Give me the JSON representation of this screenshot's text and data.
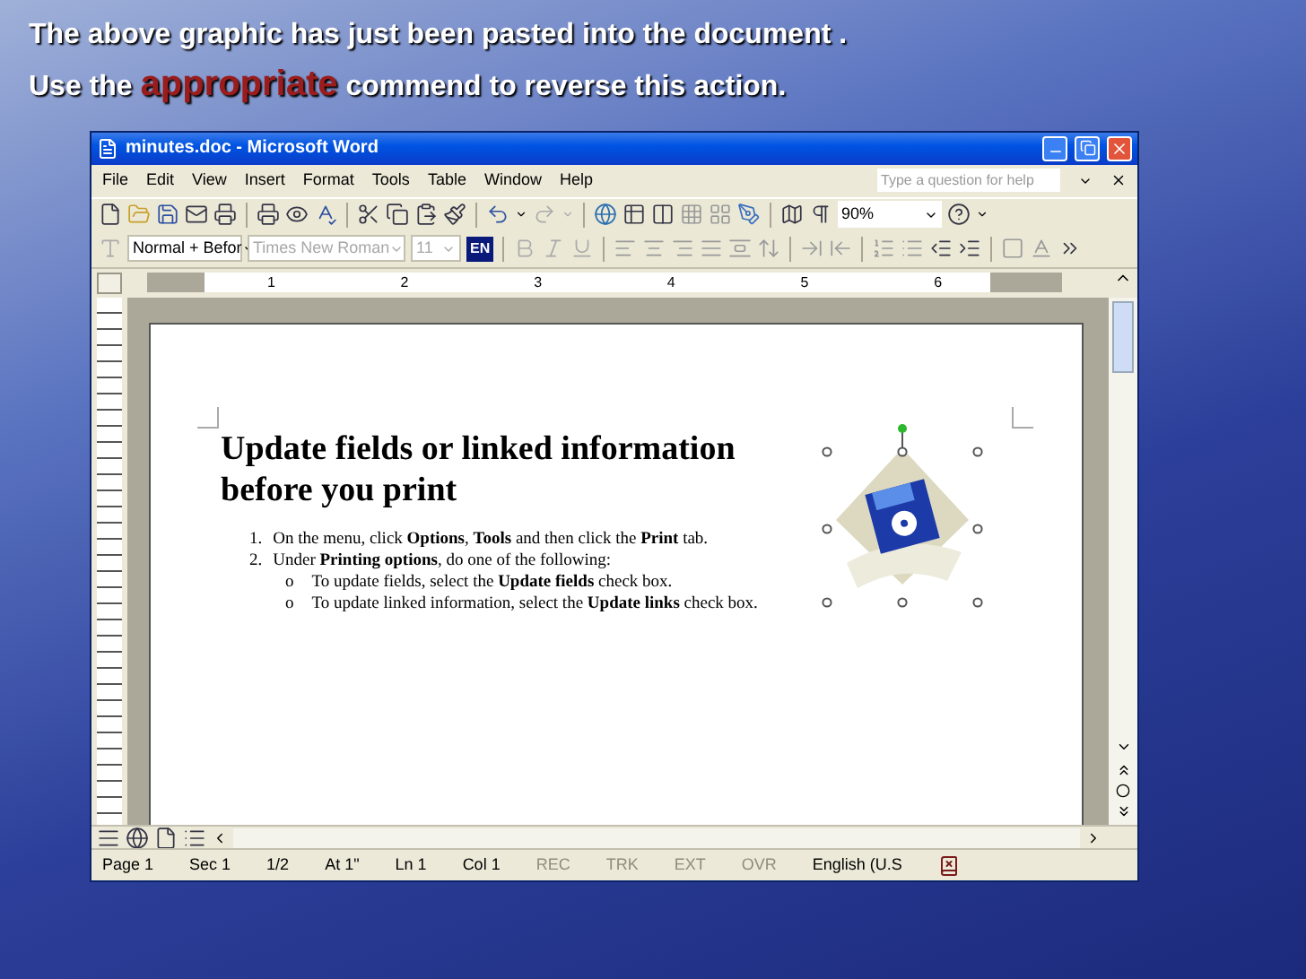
{
  "caption": {
    "line_1": "The above graphic has just been pasted into the document .",
    "line_2": [
      {
        "text": "Use the ",
        "emphasis": false
      },
      {
        "text": "appropriate",
        "emphasis": true
      },
      {
        "text": " commend to reverse this action.",
        "emphasis": false
      }
    ]
  },
  "window": {
    "title": "minutes.doc - Microsoft Word"
  },
  "menu": {
    "items": [
      "File",
      "Edit",
      "View",
      "Insert",
      "Format",
      "Tools",
      "Table",
      "Window",
      "Help"
    ],
    "help_field": {
      "placeholder": "Type a question for help"
    }
  },
  "standard_toolbar": {
    "zoom": "90%"
  },
  "formatting_toolbar": {
    "style": {
      "value": "Normal + Befor",
      "disabled": false
    },
    "font": {
      "value": "Times New Roman",
      "disabled": true
    },
    "size": {
      "value": "11",
      "disabled": true
    },
    "language": "EN"
  },
  "ruler": {
    "labels": [
      "1",
      "2",
      "3",
      "4",
      "5",
      "6"
    ]
  },
  "document": {
    "heading": "Update fields or linked information before you print",
    "steps": [
      {
        "marker": "1.",
        "text": "On the menu, click **Options**, **Tools** and then click the **Print** tab."
      },
      {
        "marker": "2.",
        "text": "Under **Printing options**, do one of the following:",
        "children": [
          {
            "marker": "o",
            "text": "To update fields, select the **Update fields** check box."
          },
          {
            "marker": "o",
            "text": "To update linked information, select the **Update links** check box."
          }
        ]
      }
    ],
    "picture": {
      "selected": true
    }
  },
  "status_bar": [
    {
      "text": "Page 1",
      "disabled": false
    },
    {
      "text": "Sec 1",
      "disabled": false
    },
    {
      "text": "1/2",
      "disabled": false
    },
    {
      "text": "At 1\"",
      "disabled": false
    },
    {
      "text": "Ln 1",
      "disabled": false
    },
    {
      "text": "Col 1",
      "disabled": false
    },
    {
      "text": "REC",
      "disabled": true
    },
    {
      "text": "TRK",
      "disabled": true
    },
    {
      "text": "EXT",
      "disabled": true
    },
    {
      "text": "OVR",
      "disabled": true
    },
    {
      "text": "English (U.S",
      "disabled": false
    }
  ]
}
